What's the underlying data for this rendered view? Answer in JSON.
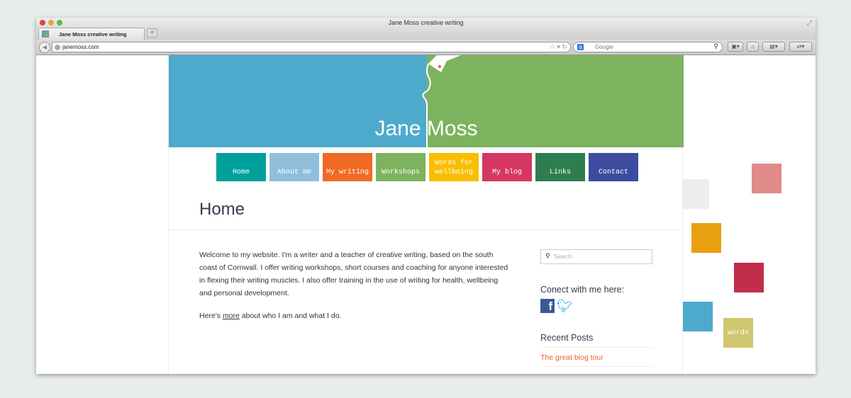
{
  "browser": {
    "window_title": "Jane Moss creative writing",
    "tab_title": "Jane Moss creative writing",
    "new_tab": "+",
    "url": "janemoss.com",
    "search_placeholder": "Google"
  },
  "site": {
    "brand": "Jane Moss",
    "nav": [
      {
        "label": "Home",
        "color": "#00a19a"
      },
      {
        "label": "About me",
        "color": "#8fbfdc"
      },
      {
        "label": "My writing",
        "color": "#f06a24"
      },
      {
        "label": "Workshops",
        "color": "#7db35f"
      },
      {
        "label": "Words for wellbeing",
        "color": "#f9be00"
      },
      {
        "label": "My blog",
        "color": "#d53763"
      },
      {
        "label": "Links",
        "color": "#2e7d4f"
      },
      {
        "label": "Contact",
        "color": "#3c4c9e"
      }
    ],
    "page_title": "Home",
    "intro": "Welcome to my website. I'm a writer and a teacher of creative writing, based on the south coast of Cornwall. I offer writing workshops, short courses and coaching for anyone interested in flexing their writing muscles. I also offer training in the use of writing for health, wellbeing and personal development.",
    "more_prefix": "Here's ",
    "more_link": "more",
    "more_suffix": " about who I am and what I do.",
    "sidebar": {
      "search_placeholder": "Search",
      "connect_heading": "Conect with me here:",
      "social": [
        "facebook-icon",
        "twitter-icon"
      ],
      "recent_heading": "Recent Posts",
      "posts": [
        "The great blog tour"
      ]
    },
    "decor_word": "words"
  }
}
